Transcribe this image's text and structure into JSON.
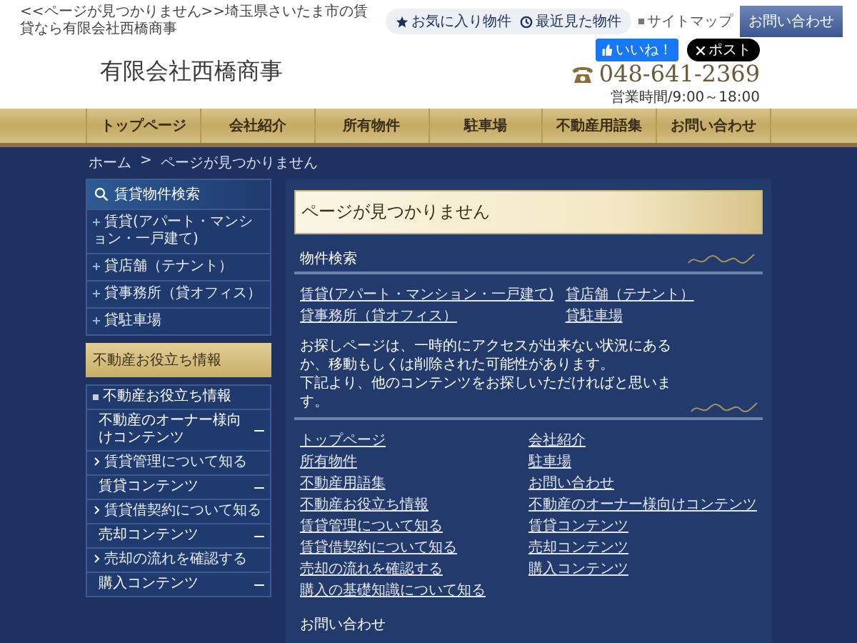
{
  "top_bar": {
    "page_caption": "<<ページが見つかりません>>埼玉県さいたま市の賃貸なら有限会社西橋商事",
    "quick_links": [
      {
        "kind": "favorite",
        "label": "お気に入り物件"
      },
      {
        "kind": "history",
        "label": "最近見た物件"
      }
    ],
    "sitemap": "サイトマップ",
    "contact_button": "お問い合わせ"
  },
  "social": {
    "like": "いいね！",
    "post": "ポスト"
  },
  "logo": "有限会社西橋商事",
  "phone": "048-641-2369",
  "hours": "営業時間/9:00～18:00",
  "nav": [
    "トップページ",
    "会社紹介",
    "所有物件",
    "駐車場",
    "不動産用語集",
    "お問い合わせ"
  ],
  "breadcrumb": {
    "items": [
      "ホーム",
      "ページが見つかりません"
    ],
    "separator": ">"
  },
  "sidebar": {
    "search": {
      "title": "賃貸物件検索",
      "items": [
        "賃貸(アパート・マンション・一戸建て)",
        "貸店舗（テナント）",
        "貸事務所（貸オフィス）",
        "貸駐車場"
      ]
    },
    "info": {
      "title": "不動産お役立ち情報",
      "head": "不動産お役立ち情報",
      "groups": [
        {
          "label": "不動産のオーナー様向けコンテンツ",
          "expanded": true,
          "children": [
            "賃貸管理について知る"
          ]
        },
        {
          "label": "賃貸コンテンツ",
          "expanded": true,
          "children": [
            "賃貸借契約について知る"
          ]
        },
        {
          "label": "売却コンテンツ",
          "expanded": true,
          "children": [
            "売却の流れを確認する"
          ]
        },
        {
          "label": "購入コンテンツ",
          "expanded": true
        }
      ]
    }
  },
  "main": {
    "title": "ページが見つかりません",
    "property_search": {
      "heading": "物件検索",
      "columns": [
        [
          "賃貸(アパート・マンション・一戸建て)",
          "貸事務所（貸オフィス）"
        ],
        [
          "貸店舗（テナント）",
          "貸駐車場"
        ]
      ]
    },
    "message": [
      "お探しページは、一時的にアクセスが出来ない状況にあるか、移動もしくは削除された可能性があります。",
      "下記より、他のコンテンツをお探しいただければと思います。"
    ],
    "links": [
      [
        "トップページ",
        "所有物件",
        "不動産用語集",
        "不動産お役立ち情報",
        "賃貸管理について知る",
        "賃貸借契約について知る",
        "売却の流れを確認する",
        "購入の基礎知識について知る"
      ],
      [
        "会社紹介",
        "駐車場",
        "お問い合わせ",
        "不動産のオーナー様向けコンテンツ",
        "賃貸コンテンツ",
        "売却コンテンツ",
        "購入コンテンツ"
      ]
    ],
    "contact_heading": "お問い合わせ"
  }
}
